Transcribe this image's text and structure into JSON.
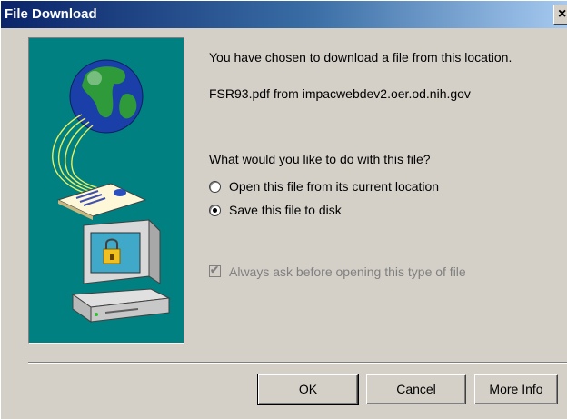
{
  "window": {
    "title": "File Download",
    "close_label": "×"
  },
  "message": {
    "intro": "You have chosen to download a file from this location.",
    "file": "FSR93.pdf from impacwebdev2.oer.od.nih.gov",
    "question": "What would you like to do with this file?"
  },
  "options": [
    {
      "label": "Open this file from its current location",
      "selected": false
    },
    {
      "label": "Save this file to disk",
      "selected": true
    }
  ],
  "always_ask": {
    "label": "Always ask before opening this type of file",
    "checked": true,
    "enabled": false
  },
  "buttons": {
    "ok": "OK",
    "cancel": "Cancel",
    "more_info": "More Info"
  },
  "colors": {
    "illustration_bg": "#008080",
    "title_start": "#0a246a",
    "title_end": "#a6caf0",
    "dialog_bg": "#d4d0c8"
  }
}
